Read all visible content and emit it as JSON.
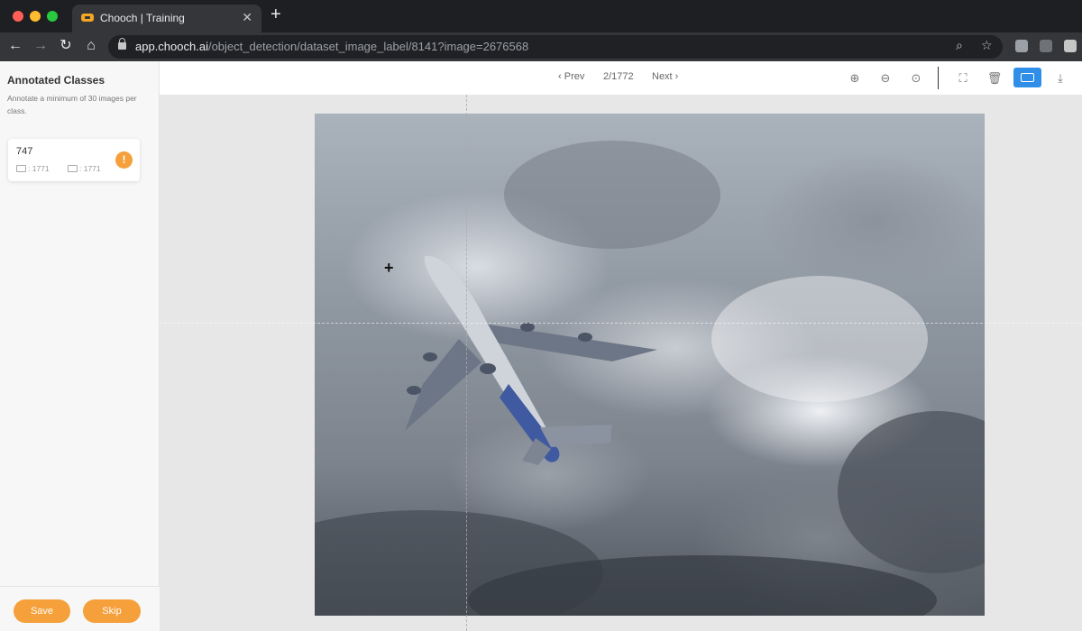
{
  "browser": {
    "tab_title": "Chooch | Training",
    "url_host": "app.chooch.ai",
    "url_path": "/object_detection/dataset_image_label/8141?image=2676568"
  },
  "sidebar": {
    "title": "Annotated Classes",
    "subtitle": "Annotate a minimum of 30 images per class.",
    "classes": [
      {
        "name": "747",
        "images_count": ": 1771",
        "boxes_count": ": 1771",
        "badge": "!"
      }
    ],
    "save_label": "Save",
    "skip_label": "Skip"
  },
  "pager": {
    "prev_label": "Prev",
    "position": "2/1772",
    "next_label": "Next"
  },
  "icons": {
    "zoom_in": "zoom-in-icon",
    "zoom_out": "zoom-out-icon",
    "zoom_reset": "zoom-reset-icon",
    "fullscreen": "fullscreen-icon",
    "delete": "trash-icon",
    "keyboard": "keyboard-icon",
    "download": "download-icon"
  },
  "colors": {
    "accent": "#f5a03a",
    "active_tool": "#2f8fe8"
  }
}
